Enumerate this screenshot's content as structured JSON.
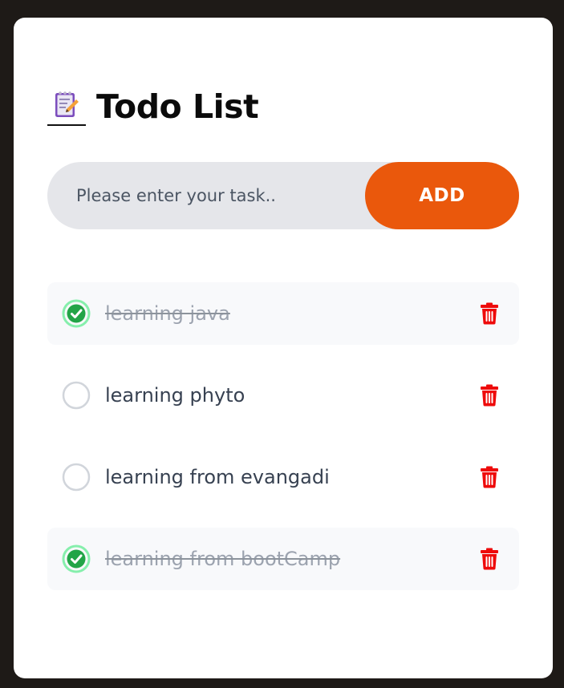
{
  "header": {
    "title": "Todo List",
    "icon": "notepad-icon"
  },
  "input": {
    "placeholder": "Please enter your task..",
    "value": ""
  },
  "add_button": {
    "label": "ADD"
  },
  "colors": {
    "background": "#1e1a17",
    "card": "#ffffff",
    "accent": "#ea580c",
    "check": "#22c55e",
    "delete": "#ee0a0a"
  },
  "todos": [
    {
      "text": "learning java",
      "done": true
    },
    {
      "text": "learning phyto",
      "done": false
    },
    {
      "text": "learning from evangadi",
      "done": false
    },
    {
      "text": "learning from bootCamp",
      "done": true
    }
  ]
}
